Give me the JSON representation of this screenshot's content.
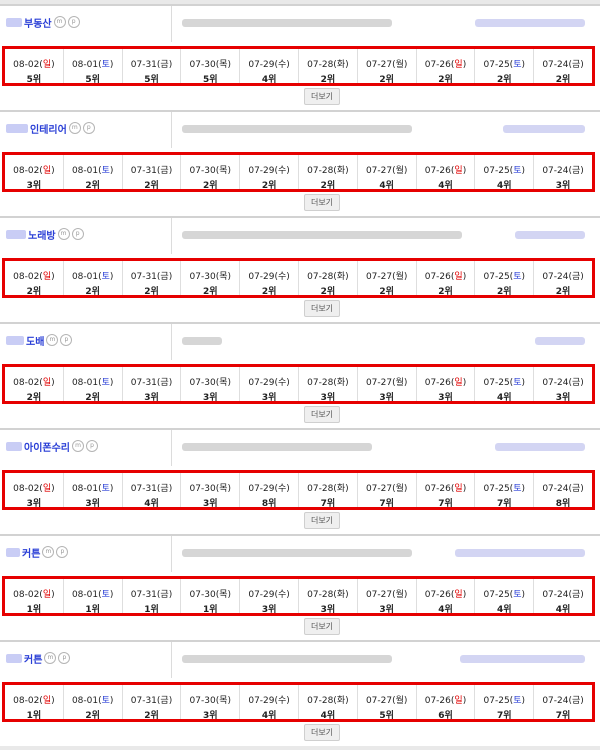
{
  "more_label": "더보기",
  "badge_m": "m",
  "badge_p": "p",
  "colors": {
    "sunday": "#e00000",
    "saturday": "#2a3fd6",
    "highlight": "#e60000"
  },
  "sections": [
    {
      "keyword": "부동산",
      "days": [
        {
          "date": "08-02",
          "day": "일",
          "rank": "5위"
        },
        {
          "date": "08-01",
          "day": "토",
          "rank": "5위"
        },
        {
          "date": "07-31",
          "day": "금",
          "rank": "5위"
        },
        {
          "date": "07-30",
          "day": "목",
          "rank": "5위"
        },
        {
          "date": "07-29",
          "day": "수",
          "rank": "4위"
        },
        {
          "date": "07-28",
          "day": "화",
          "rank": "2위"
        },
        {
          "date": "07-27",
          "day": "월",
          "rank": "2위"
        },
        {
          "date": "07-26",
          "day": "일",
          "rank": "2위"
        },
        {
          "date": "07-25",
          "day": "토",
          "rank": "2위"
        },
        {
          "date": "07-24",
          "day": "금",
          "rank": "2위"
        }
      ]
    },
    {
      "keyword": "인테리어",
      "days": [
        {
          "date": "08-02",
          "day": "일",
          "rank": "3위"
        },
        {
          "date": "08-01",
          "day": "토",
          "rank": "2위"
        },
        {
          "date": "07-31",
          "day": "금",
          "rank": "2위"
        },
        {
          "date": "07-30",
          "day": "목",
          "rank": "2위"
        },
        {
          "date": "07-29",
          "day": "수",
          "rank": "2위"
        },
        {
          "date": "07-28",
          "day": "화",
          "rank": "2위"
        },
        {
          "date": "07-27",
          "day": "월",
          "rank": "4위"
        },
        {
          "date": "07-26",
          "day": "일",
          "rank": "4위"
        },
        {
          "date": "07-25",
          "day": "토",
          "rank": "4위"
        },
        {
          "date": "07-24",
          "day": "금",
          "rank": "3위"
        }
      ]
    },
    {
      "keyword": "노래방",
      "days": [
        {
          "date": "08-02",
          "day": "일",
          "rank": "2위"
        },
        {
          "date": "08-01",
          "day": "토",
          "rank": "2위"
        },
        {
          "date": "07-31",
          "day": "금",
          "rank": "2위"
        },
        {
          "date": "07-30",
          "day": "목",
          "rank": "2위"
        },
        {
          "date": "07-29",
          "day": "수",
          "rank": "2위"
        },
        {
          "date": "07-28",
          "day": "화",
          "rank": "2위"
        },
        {
          "date": "07-27",
          "day": "월",
          "rank": "2위"
        },
        {
          "date": "07-26",
          "day": "일",
          "rank": "2위"
        },
        {
          "date": "07-25",
          "day": "토",
          "rank": "2위"
        },
        {
          "date": "07-24",
          "day": "금",
          "rank": "2위"
        }
      ]
    },
    {
      "keyword": "도배",
      "days": [
        {
          "date": "08-02",
          "day": "일",
          "rank": "2위"
        },
        {
          "date": "08-01",
          "day": "토",
          "rank": "2위"
        },
        {
          "date": "07-31",
          "day": "금",
          "rank": "3위"
        },
        {
          "date": "07-30",
          "day": "목",
          "rank": "3위"
        },
        {
          "date": "07-29",
          "day": "수",
          "rank": "3위"
        },
        {
          "date": "07-28",
          "day": "화",
          "rank": "3위"
        },
        {
          "date": "07-27",
          "day": "월",
          "rank": "3위"
        },
        {
          "date": "07-26",
          "day": "일",
          "rank": "3위"
        },
        {
          "date": "07-25",
          "day": "토",
          "rank": "4위"
        },
        {
          "date": "07-24",
          "day": "금",
          "rank": "3위"
        }
      ]
    },
    {
      "keyword": "아이폰수리",
      "days": [
        {
          "date": "08-02",
          "day": "일",
          "rank": "3위"
        },
        {
          "date": "08-01",
          "day": "토",
          "rank": "3위"
        },
        {
          "date": "07-31",
          "day": "금",
          "rank": "4위"
        },
        {
          "date": "07-30",
          "day": "목",
          "rank": "3위"
        },
        {
          "date": "07-29",
          "day": "수",
          "rank": "8위"
        },
        {
          "date": "07-28",
          "day": "화",
          "rank": "7위"
        },
        {
          "date": "07-27",
          "day": "월",
          "rank": "7위"
        },
        {
          "date": "07-26",
          "day": "일",
          "rank": "7위"
        },
        {
          "date": "07-25",
          "day": "토",
          "rank": "7위"
        },
        {
          "date": "07-24",
          "day": "금",
          "rank": "8위"
        }
      ]
    },
    {
      "keyword": "커튼",
      "days": [
        {
          "date": "08-02",
          "day": "일",
          "rank": "1위"
        },
        {
          "date": "08-01",
          "day": "토",
          "rank": "1위"
        },
        {
          "date": "07-31",
          "day": "금",
          "rank": "1위"
        },
        {
          "date": "07-30",
          "day": "목",
          "rank": "1위"
        },
        {
          "date": "07-29",
          "day": "수",
          "rank": "3위"
        },
        {
          "date": "07-28",
          "day": "화",
          "rank": "3위"
        },
        {
          "date": "07-27",
          "day": "월",
          "rank": "3위"
        },
        {
          "date": "07-26",
          "day": "일",
          "rank": "4위"
        },
        {
          "date": "07-25",
          "day": "토",
          "rank": "4위"
        },
        {
          "date": "07-24",
          "day": "금",
          "rank": "4위"
        }
      ]
    },
    {
      "keyword": "커튼",
      "days": [
        {
          "date": "08-02",
          "day": "일",
          "rank": "1위"
        },
        {
          "date": "08-01",
          "day": "토",
          "rank": "2위"
        },
        {
          "date": "07-31",
          "day": "금",
          "rank": "2위"
        },
        {
          "date": "07-30",
          "day": "목",
          "rank": "3위"
        },
        {
          "date": "07-29",
          "day": "수",
          "rank": "4위"
        },
        {
          "date": "07-28",
          "day": "화",
          "rank": "4위"
        },
        {
          "date": "07-27",
          "day": "월",
          "rank": "5위"
        },
        {
          "date": "07-26",
          "day": "일",
          "rank": "6위"
        },
        {
          "date": "07-25",
          "day": "토",
          "rank": "7위"
        },
        {
          "date": "07-24",
          "day": "금",
          "rank": "7위"
        }
      ]
    }
  ]
}
